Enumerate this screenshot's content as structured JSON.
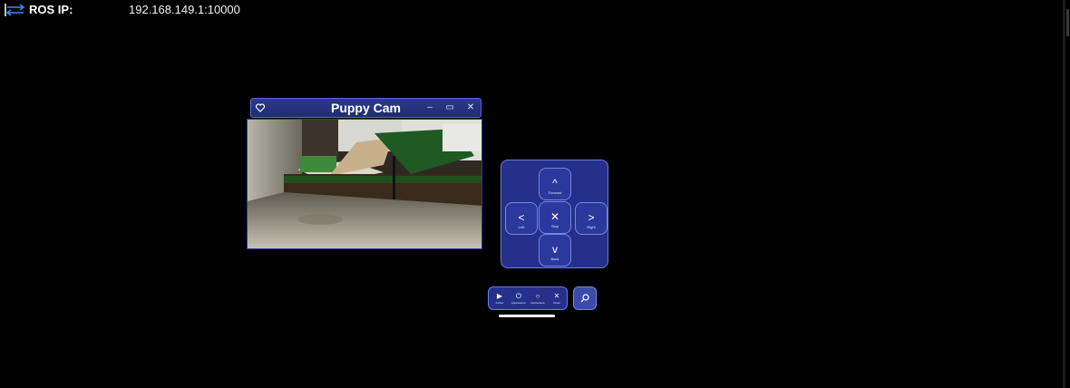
{
  "header": {
    "ros_label": "ROS IP:",
    "ros_value": "192.168.149.1:10000"
  },
  "camera_window": {
    "title": "Puppy Cam",
    "minimize_glyph": "–",
    "maximize_glyph": "▭",
    "close_glyph": "✕"
  },
  "dpad": {
    "forward": {
      "glyph": "^",
      "label": "Forward"
    },
    "left": {
      "glyph": "<",
      "label": "Left"
    },
    "stop": {
      "glyph": "✕",
      "label": "Stop"
    },
    "right": {
      "glyph": ">",
      "label": "Right"
    },
    "back": {
      "glyph": "v",
      "label": "Back"
    }
  },
  "toolbar": {
    "follow": {
      "glyph": "▶",
      "label": "Follow"
    },
    "appearance": {
      "glyph": "⏻",
      "label": "Appearance"
    },
    "gestures": {
      "glyph": "○",
      "label": "GetGesture"
    },
    "close": {
      "glyph": "✕",
      "label": "Close"
    }
  },
  "colors": {
    "panel_bg": "#24308a",
    "panel_border": "#6c7be0",
    "title_bar": "#2c3a8c",
    "background": "#000000"
  }
}
